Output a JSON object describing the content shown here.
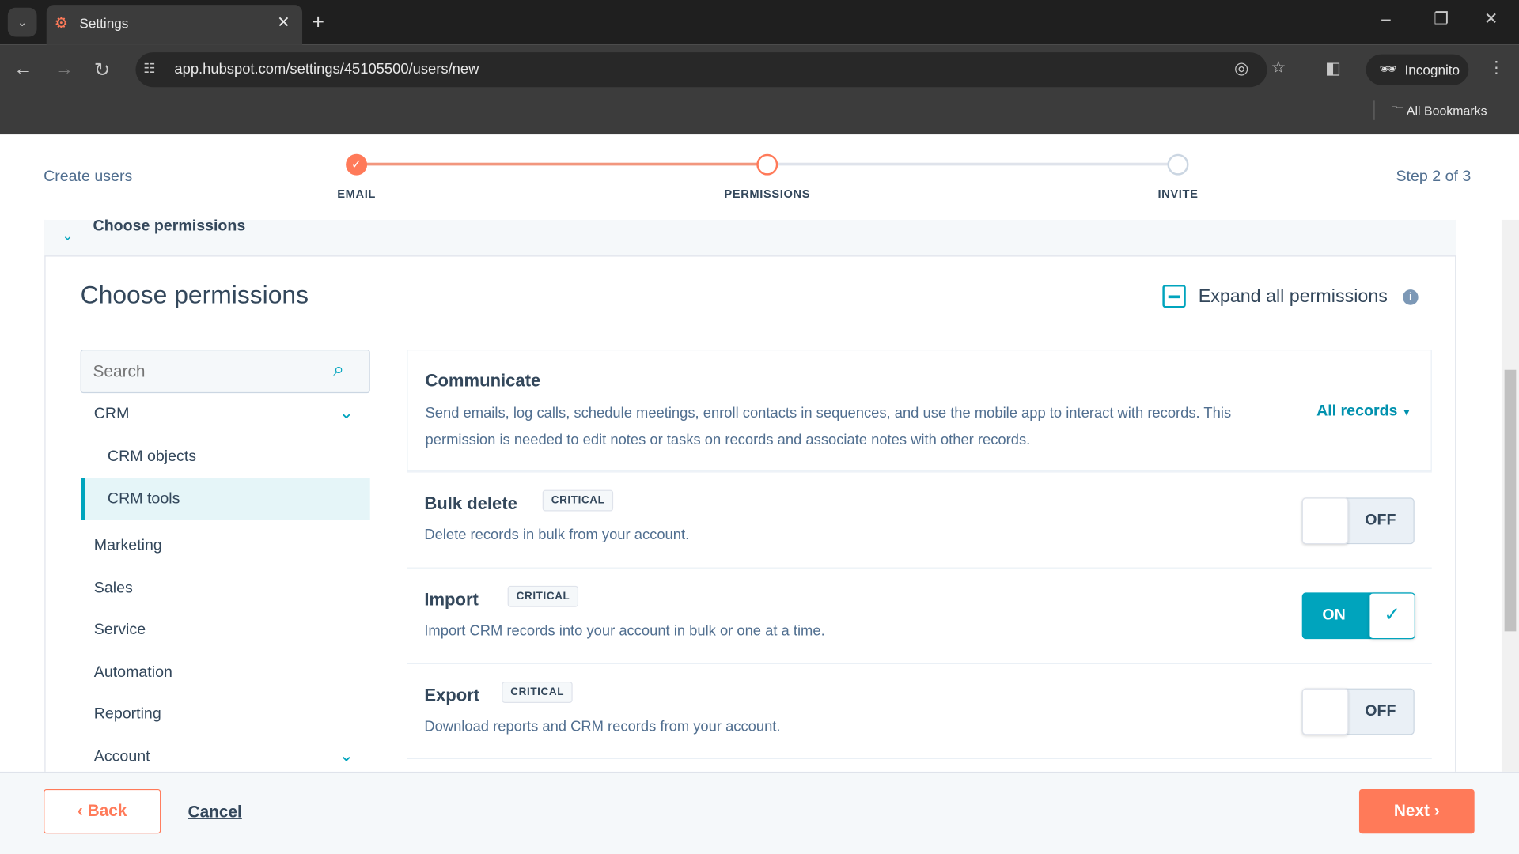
{
  "browser": {
    "tab_title": "Settings",
    "url": "app.hubspot.com/settings/45105500/users/new",
    "incognito": "Incognito",
    "bookmarks": "All Bookmarks"
  },
  "header": {
    "title": "Create users",
    "step": "Step 2 of 3",
    "steps": [
      {
        "label": "EMAIL",
        "state": "done"
      },
      {
        "label": "PERMISSIONS",
        "state": "current"
      },
      {
        "label": "INVITE",
        "state": "pending"
      }
    ]
  },
  "panel": {
    "collapse_title": "Choose permissions",
    "title": "Choose permissions",
    "expand_all": "Expand all permissions"
  },
  "search": {
    "placeholder": "Search"
  },
  "sidebar": {
    "items": [
      {
        "label": "CRM",
        "expandable": true
      },
      {
        "label": "CRM objects"
      },
      {
        "label": "CRM tools",
        "selected": true
      },
      {
        "label": "Marketing"
      },
      {
        "label": "Sales"
      },
      {
        "label": "Service"
      },
      {
        "label": "Automation"
      },
      {
        "label": "Reporting"
      },
      {
        "label": "Account",
        "expandable": true
      }
    ]
  },
  "permissions": [
    {
      "title": "Communicate",
      "desc": "Send emails, log calls, schedule meetings, enroll contacts in sequences, and use the mobile app to interact with records. This permission is needed to edit notes or tasks on records and associate notes with other records.",
      "dropdown": "All records"
    },
    {
      "title": "Bulk delete",
      "badge": "CRITICAL",
      "desc": "Delete records in bulk from your account.",
      "toggle": "OFF"
    },
    {
      "title": "Import",
      "badge": "CRITICAL",
      "desc": "Import CRM records into your account in bulk or one at a time.",
      "toggle": "ON"
    },
    {
      "title": "Export",
      "badge": "CRITICAL",
      "desc": "Download reports and CRM records from your account.",
      "toggle": "OFF"
    }
  ],
  "footer": {
    "back": "Back",
    "cancel": "Cancel",
    "next": "Next"
  },
  "colors": {
    "accent": "#ff7a59",
    "teal": "#00a4bd",
    "text": "#33475b"
  }
}
